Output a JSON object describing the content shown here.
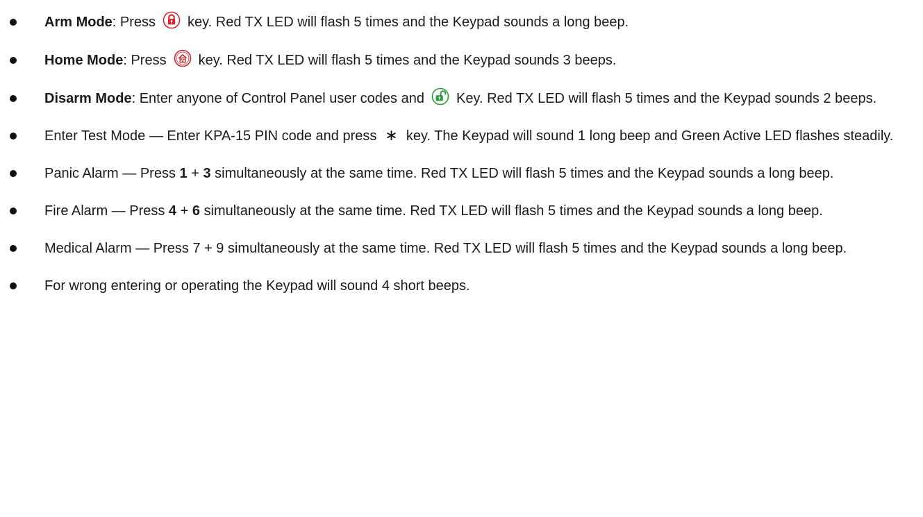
{
  "colors": {
    "text": "#1a1a1a",
    "arm_icon": "#d8242d",
    "home_icon": "#c9252c",
    "disarm_icon": "#2b9b3a"
  },
  "items": [
    {
      "bold": "Arm Mode",
      "pre": ": Press",
      "icon": "arm-lock-icon",
      "post": "key. Red TX LED will flash 5 times and the Keypad sounds a long beep."
    },
    {
      "bold": "Home Mode",
      "pre": ": Press",
      "icon": "home-key-icon",
      "post": "key. Red TX LED will flash 5 times and the Keypad sounds 3 beeps."
    },
    {
      "bold": "Disarm Mode",
      "pre": ": Enter anyone of Control Panel user codes and",
      "icon": "disarm-unlock-icon",
      "post": "Key. Red TX LED will flash 5 times and the Keypad sounds 2 beeps."
    },
    {
      "pre": "Enter Test Mode — Enter KPA-15 PIN code and press",
      "star": "∗",
      "post": "key. The Keypad will sound 1 long beep and Green Active LED flashes steadily."
    },
    {
      "pre": "Panic Alarm — Press",
      "k1": "1",
      "plus": "+",
      "k2": "3",
      "post": "simultaneously at the same time. Red TX LED will flash 5 times and the Keypad sounds a long beep."
    },
    {
      "pre": "Fire Alarm — Press",
      "k1": "4",
      "plus": "+",
      "k2": "6",
      "post": "simultaneously at the same time. Red TX LED will flash 5 times and the Keypad sounds a long beep."
    },
    {
      "text": "Medical Alarm — Press 7 + 9 simultaneously at the same time. Red TX LED will flash 5 times and the Keypad sounds a long beep."
    },
    {
      "text": "For wrong entering or operating the Keypad will sound 4 short beeps."
    }
  ]
}
